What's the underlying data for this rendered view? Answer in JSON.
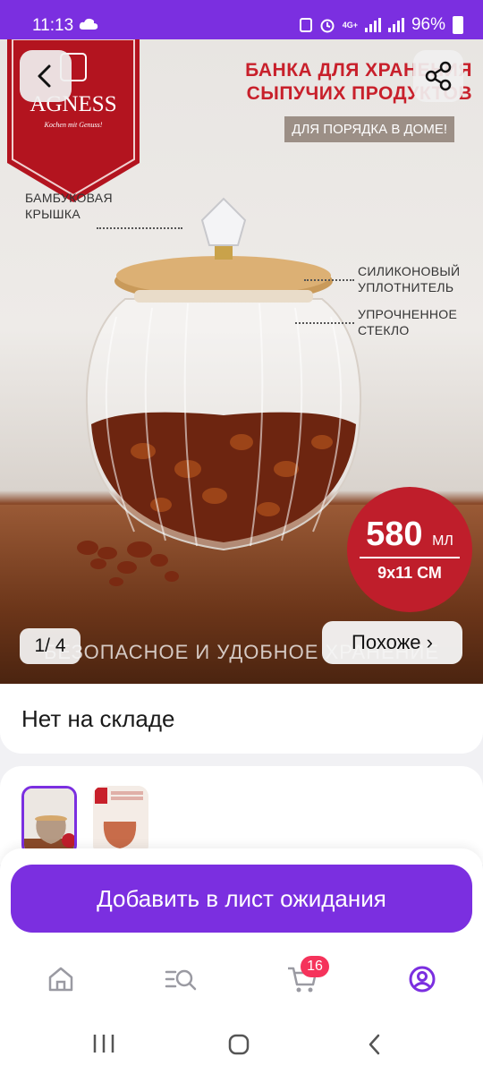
{
  "status_bar": {
    "time": "11:13",
    "network": "4G+",
    "battery": "96%"
  },
  "hero": {
    "brand": "AGNESS",
    "brand_tagline": "Kochen mit Genuss!",
    "headline_line1": "БАНКА ДЛЯ ХРАНЕНИЯ",
    "headline_line2": "СЫПУЧИХ ПРОДУКТОВ",
    "sub_badge": "ДЛЯ ПОРЯДКА В ДОМЕ!",
    "lid_label_line1": "БАМБУКОВАЯ",
    "lid_label_line2": "КРЫШКА",
    "seal_label_line1": "СИЛИКОНОВЫЙ",
    "seal_label_line2": "УПЛОТНИТЕЛЬ",
    "glass_label_line1": "УПРОЧНЕННОЕ",
    "glass_label_line2": "СТЕКЛО",
    "volume": "580",
    "volume_unit": "МЛ",
    "size": "9x11 СМ",
    "bottom_caption": "БЕЗОПАСНОЕ И УДОБНОЕ ХРАНЕНИЕ",
    "image_counter": "1/ 4",
    "similar_button": "Похоже ›"
  },
  "stock": {
    "status": "Нет на складе"
  },
  "thumbnails": [
    {
      "name": "thumb-1",
      "selected": true
    },
    {
      "name": "thumb-2",
      "selected": false
    }
  ],
  "actions": {
    "waitlist_button": "Добавить в лист ожидания"
  },
  "bottom_nav": {
    "items": [
      "home-icon",
      "catalog-search-icon",
      "cart-icon",
      "profile-icon"
    ],
    "cart_badge": "16"
  },
  "colors": {
    "accent": "#7b2fe0",
    "badge": "#f5335b",
    "brand_red": "#c8202b"
  }
}
